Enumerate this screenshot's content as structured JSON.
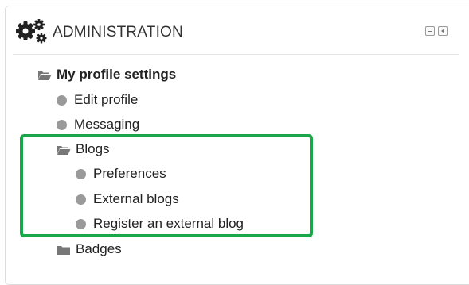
{
  "block": {
    "title": "ADMINISTRATION",
    "title_icon": "gears-icon",
    "controls": [
      "minimize-icon",
      "dock-icon"
    ]
  },
  "tree": {
    "profile_settings": {
      "label": "My profile settings",
      "icon": "folder-open-icon",
      "items": {
        "edit_profile": "Edit profile",
        "messaging": "Messaging",
        "blogs": {
          "label": "Blogs",
          "icon": "folder-open-icon",
          "items": {
            "preferences": "Preferences",
            "external_blogs": "External blogs",
            "register": "Register an external blog"
          }
        },
        "badges": {
          "label": "Badges",
          "icon": "folder-closed-icon"
        }
      }
    }
  },
  "colors": {
    "highlight": "#1ca64b",
    "bullet": "#9a9a9a",
    "text": "#222222"
  }
}
